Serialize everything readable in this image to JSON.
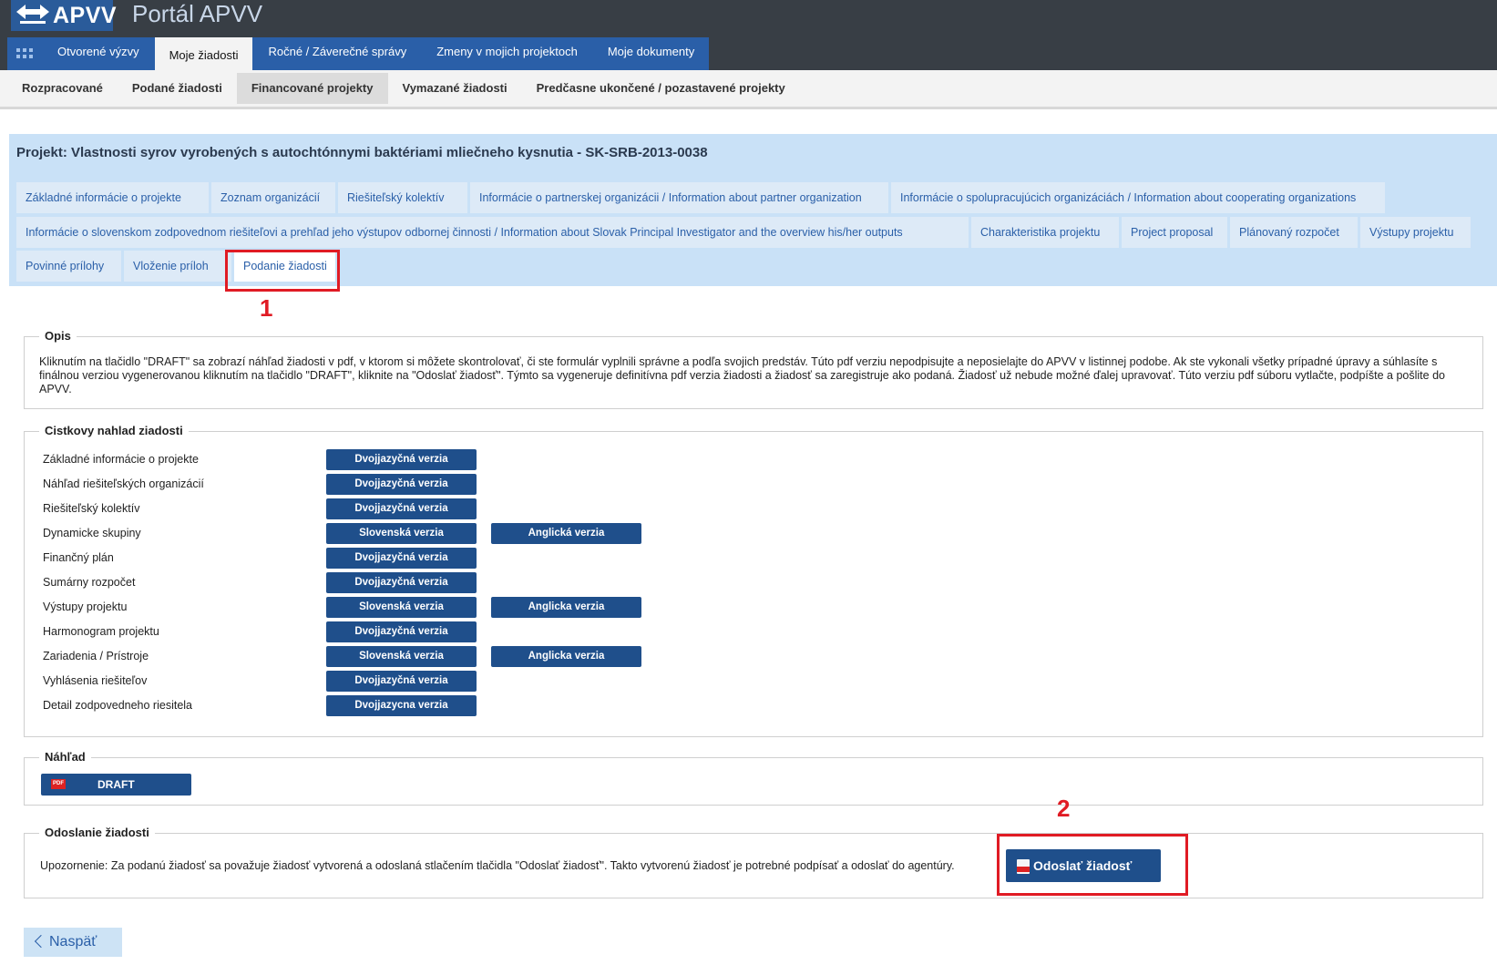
{
  "header": {
    "logo_text": "APVV",
    "portal_title": "Portál APVV"
  },
  "main_nav": [
    {
      "label": "Otvorené výzvy",
      "active": false
    },
    {
      "label": "Moje žiadosti",
      "active": true
    },
    {
      "label": "Ročné / Záverečné správy",
      "active": false
    },
    {
      "label": "Zmeny v mojich projektoch",
      "active": false
    },
    {
      "label": "Moje dokumenty",
      "active": false
    }
  ],
  "sub_nav": [
    {
      "label": "Rozpracované",
      "active": false
    },
    {
      "label": "Podané žiadosti",
      "active": false
    },
    {
      "label": "Financované projekty",
      "active": true
    },
    {
      "label": "Vymazané žiadosti",
      "active": false
    },
    {
      "label": "Predčasne ukončené / pozastavené projekty",
      "active": false
    }
  ],
  "project": {
    "title": "Projekt: Vlastnosti syrov vyrobených s autochtónnymi baktériami mliečneho kysnutia - SK-SRB-2013-0038",
    "tabs": [
      "Základné informácie o projekte",
      "Zoznam organizácií",
      "Riešiteľský kolektív",
      "Informácie o partnerskej organizácii / Information about partner organization",
      "Informácie o spolupracujúcich organizáciách / Information about cooperating organizations",
      "Informácie o slovenskom zodpovednom riešiteľovi a prehľad jeho výstupov odbornej činnosti / Information about Slovak Principal Investigator and the overview his/her outputs",
      "Charakteristika projektu",
      "Project proposal",
      "Plánovaný rozpočet",
      "Výstupy projektu",
      "Povinné prílohy",
      "Vloženie príloh",
      "Podanie žiadosti"
    ],
    "active_tab": "Podanie žiadosti"
  },
  "markers": {
    "one": "1",
    "two": "2"
  },
  "opis": {
    "legend": "Opis",
    "text": "Kliknutím na tlačidlo \"DRAFT\" sa zobrazí náhľad žiadosti v pdf, v ktorom si môžete skontrolovať, či ste formulár vyplnili správne a podľa svojich predstáv. Túto pdf verziu nepodpisujte a neposielajte do APVV v listinnej podobe. Ak ste vykonali všetky prípadné úpravy a súhlasíte s finálnou verziou vygenerovanou kliknutím na tlačidlo \"DRAFT\", kliknite na \"Odoslať žiadosť\". Týmto sa vygeneruje definitívna pdf verzia žiadosti a žiadosť sa zaregistruje ako podaná. Žiadosť už nebude možné ďalej upravovať. Túto verziu pdf súboru vytlačte, podpíšte a pošlite do APVV."
  },
  "preview": {
    "legend": "Cistkovy nahlad ziadosti",
    "rows": [
      {
        "label": "Základné informácie o projekte",
        "buttons": [
          "Dvojjazyčná verzia"
        ]
      },
      {
        "label": "Náhľad riešiteľských organizácií",
        "buttons": [
          "Dvojjazyčná verzia"
        ]
      },
      {
        "label": "Riešiteľský kolektív",
        "buttons": [
          "Dvojjazyčná verzia"
        ]
      },
      {
        "label": "Dynamicke skupiny",
        "buttons": [
          "Slovenská verzia",
          "Anglická verzia"
        ]
      },
      {
        "label": "Finančný plán",
        "buttons": [
          "Dvojjazyčná verzia"
        ]
      },
      {
        "label": "Sumárny rozpočet",
        "buttons": [
          "Dvojjazyčná verzia"
        ]
      },
      {
        "label": "Výstupy projektu",
        "buttons": [
          "Slovenská verzia",
          "Anglicka verzia"
        ]
      },
      {
        "label": "Harmonogram projektu",
        "buttons": [
          "Dvojjazyčná verzia"
        ]
      },
      {
        "label": "Zariadenia / Prístroje",
        "buttons": [
          "Slovenská verzia",
          "Anglicka verzia"
        ]
      },
      {
        "label": "Vyhlásenia riešiteľov",
        "buttons": [
          "Dvojjazyčná verzia"
        ]
      },
      {
        "label": "Detail zodpovedneho riesitela",
        "buttons": [
          "Dvojjazycna verzia"
        ]
      }
    ]
  },
  "nahlad": {
    "legend": "Náhľad",
    "draft_label": "DRAFT",
    "pdf_badge": "PDF"
  },
  "odoslanie": {
    "legend": "Odoslanie žiadosti",
    "text": "Upozornenie: Za podanú žiadosť sa považuje žiadosť vytvorená a odoslaná stlačením tlačidla \"Odoslať žiadosť\". Takto vytvorenú žiadosť je potrebné podpísať a odoslať do agentúry.",
    "send_label": "Odoslať žiadosť"
  },
  "back_label": "Naspäť",
  "colors": {
    "topbar": "#383e45",
    "nav_blue": "#2a5fa8",
    "button_blue": "#1f4f8b",
    "panel_blue": "#c9e1f7",
    "highlight_red": "#e01b24"
  }
}
